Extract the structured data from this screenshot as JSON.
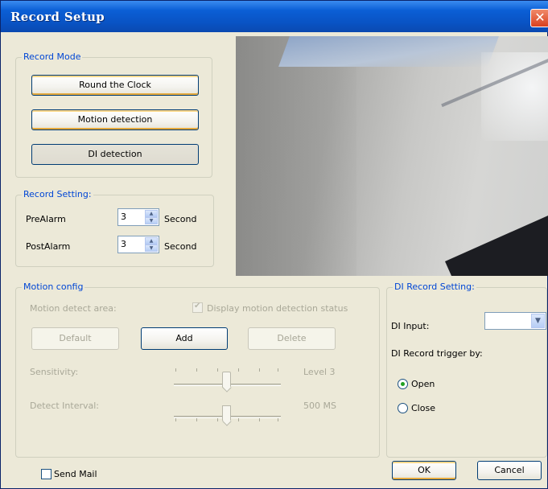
{
  "window": {
    "title": "Record Setup",
    "close_glyph": "✕"
  },
  "record_mode": {
    "label": "Record Mode",
    "buttons": [
      "Round the Clock",
      "Motion detection",
      "DI detection"
    ]
  },
  "record_setting": {
    "label": "Record Setting:",
    "prealarm": {
      "label": "PreAlarm",
      "value": "3",
      "unit": "Second"
    },
    "postalarm": {
      "label": "PostAlarm",
      "value": "3",
      "unit": "Second"
    }
  },
  "motion_config": {
    "label": "Motion config",
    "area_label": "Motion detect area:",
    "display_status_label": "Display motion detection status",
    "display_status_checked": true,
    "default_label": "Default",
    "add_label": "Add",
    "delete_label": "Delete",
    "sensitivity_label": "Sensitivity:",
    "sensitivity_value": "Level 3",
    "sensitivity_level": 3,
    "interval_label": "Detect Interval:",
    "interval_value": "500 MS"
  },
  "di_record": {
    "label": "DI Record Setting:",
    "input_label": "DI Input:",
    "input_value": "",
    "trigger_label": "DI Record trigger by:",
    "options": [
      "Open",
      "Close"
    ],
    "selected": "Open"
  },
  "footer": {
    "send_mail_label": "Send Mail",
    "send_mail_checked": false,
    "ok_label": "OK",
    "cancel_label": "Cancel"
  },
  "colors": {
    "title_bar": "#0a5fd6",
    "group_label": "#0046d5",
    "window_bg": "#ece9d8"
  }
}
